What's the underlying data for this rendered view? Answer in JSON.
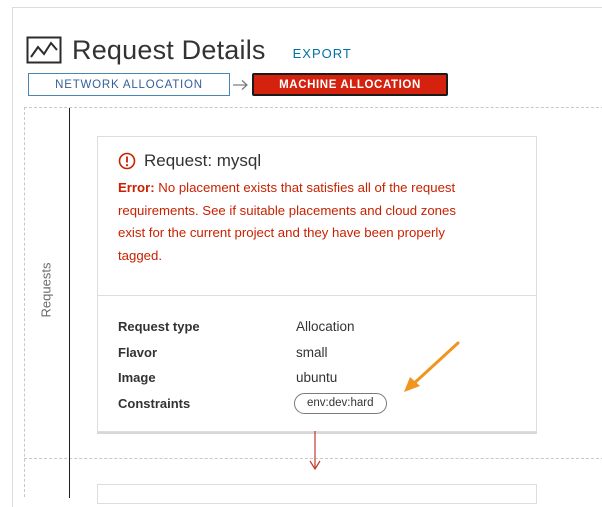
{
  "header": {
    "title": "Request Details",
    "export_label": "EXPORT"
  },
  "breadcrumb": {
    "network_label": "NETWORK ALLOCATION",
    "machine_label": "MACHINE ALLOCATION"
  },
  "rail": {
    "label": "Requests"
  },
  "request_card": {
    "title": "Request: mysql",
    "error_prefix": "Error:",
    "error_lines": [
      " No placement exists that satisfies all of the request",
      "requirements. See if suitable placements and cloud zones",
      "exist for the current project and they have been properly",
      "tagged."
    ],
    "properties": [
      {
        "key": "Request type",
        "value": "Allocation"
      },
      {
        "key": "Flavor",
        "value": "small"
      },
      {
        "key": "Image",
        "value": "ubuntu"
      },
      {
        "key": "Constraints",
        "value": "env:dev:hard"
      }
    ]
  },
  "colors": {
    "accent_link": "#0072a3",
    "error": "#c92100",
    "active_step": "#d4220e",
    "annotation_arrow": "#f0951e"
  }
}
